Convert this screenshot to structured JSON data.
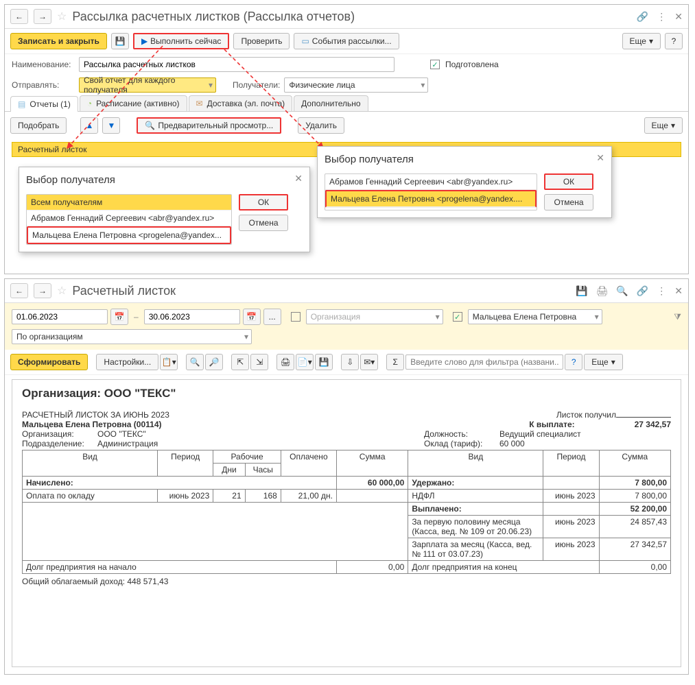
{
  "win1": {
    "title": "Рассылка расчетных листков (Рассылка отчетов)",
    "save_close": "Записать и закрыть",
    "run_now": "Выполнить сейчас",
    "check": "Проверить",
    "events": "События рассылки...",
    "more": "Еще",
    "help": "?",
    "name_label": "Наименование:",
    "name_value": "Рассылка расчетных листков",
    "prepared": "Подготовлена",
    "send_label": "Отправлять:",
    "send_value": "Свой отчет для каждого получателя",
    "recipients_label": "Получатели:",
    "recipients_value": "Физические лица",
    "tabs": {
      "reports": "Отчеты (1)",
      "schedule": "Расписание (активно)",
      "delivery": "Доставка (эл. почта)",
      "extra": "Дополнительно"
    },
    "pick": "Подобрать",
    "preview": "Предварительный просмотр...",
    "delete": "Удалить",
    "strip": "Расчетный листок",
    "popup1": {
      "title": "Выбор получателя",
      "all": "Всем получателям",
      "r1": "Абрамов Геннадий Сергеевич <abr@yandex.ru>",
      "r2": "Мальцева Елена Петровна <progelena@yandex...",
      "ok": "ОК",
      "cancel": "Отмена"
    },
    "popup2": {
      "title": "Выбор получателя",
      "r1": "Абрамов Геннадий Сергеевич <abr@yandex.ru>",
      "r2": "Мальцева Елена Петровна <progelena@yandex....",
      "ok": "ОК",
      "cancel": "Отмена"
    }
  },
  "win2": {
    "title": "Расчетный листок",
    "date_from": "01.06.2023",
    "date_to": "30.06.2023",
    "org_ph": "Организация",
    "employee": "Мальцева Елена Петровна",
    "group_by": "По организациям",
    "generate": "Сформировать",
    "settings": "Настройки...",
    "filter_ph": "Введите слово для фильтра (названи...",
    "help": "?",
    "more": "Еще",
    "report": {
      "org_header": "Организация: ООО \"ТЕКС\"",
      "period_title": "РАСЧЕТНЫЙ ЛИСТОК ЗА ИЮНЬ 2023",
      "received": "Листок получил",
      "employee": "Мальцева Елена Петровна (00114)",
      "to_pay_l": "К выплате:",
      "to_pay_v": "27 342,57",
      "org_l": "Организация:",
      "org_v": "ООО \"ТЕКС\"",
      "pos_l": "Должность:",
      "pos_v": "Ведущий специалист",
      "dept_l": "Подразделение:",
      "dept_v": "Администрация",
      "salary_l": "Оклад (тариф):",
      "salary_v": "60 000",
      "cols": {
        "vid": "Вид",
        "period": "Период",
        "work": "Рабочие",
        "days": "Дни",
        "hours": "Часы",
        "paid": "Оплачено",
        "sum": "Сумма"
      },
      "accrued": "Начислено:",
      "accrued_sum": "60 000,00",
      "row_salary": {
        "name": "Оплата по окладу",
        "period": "июнь 2023",
        "days": "21",
        "hours": "168",
        "paid": "21,00 дн.",
        "sum": ""
      },
      "withheld": "Удержано:",
      "withheld_sum": "7 800,00",
      "ndfl": {
        "name": "НДФЛ",
        "period": "июнь 2023",
        "sum": "7 800,00"
      },
      "paid_l": "Выплачено:",
      "paid_sum": "52 200,00",
      "pay1": {
        "name": "За первую половину месяца (Касса, вед. № 109 от 20.06.23)",
        "period": "июнь 2023",
        "sum": "24 857,43"
      },
      "pay2": {
        "name": "Зарплата за месяц (Касса, вед. № 111 от 03.07.23)",
        "period": "июнь 2023",
        "sum": "27 342,57"
      },
      "debt_start_l": "Долг предприятия на начало",
      "debt_start_v": "0,00",
      "debt_end_l": "Долг предприятия на конец",
      "debt_end_v": "0,00",
      "tax_base": "Общий облагаемый доход: 448 571,43"
    }
  }
}
